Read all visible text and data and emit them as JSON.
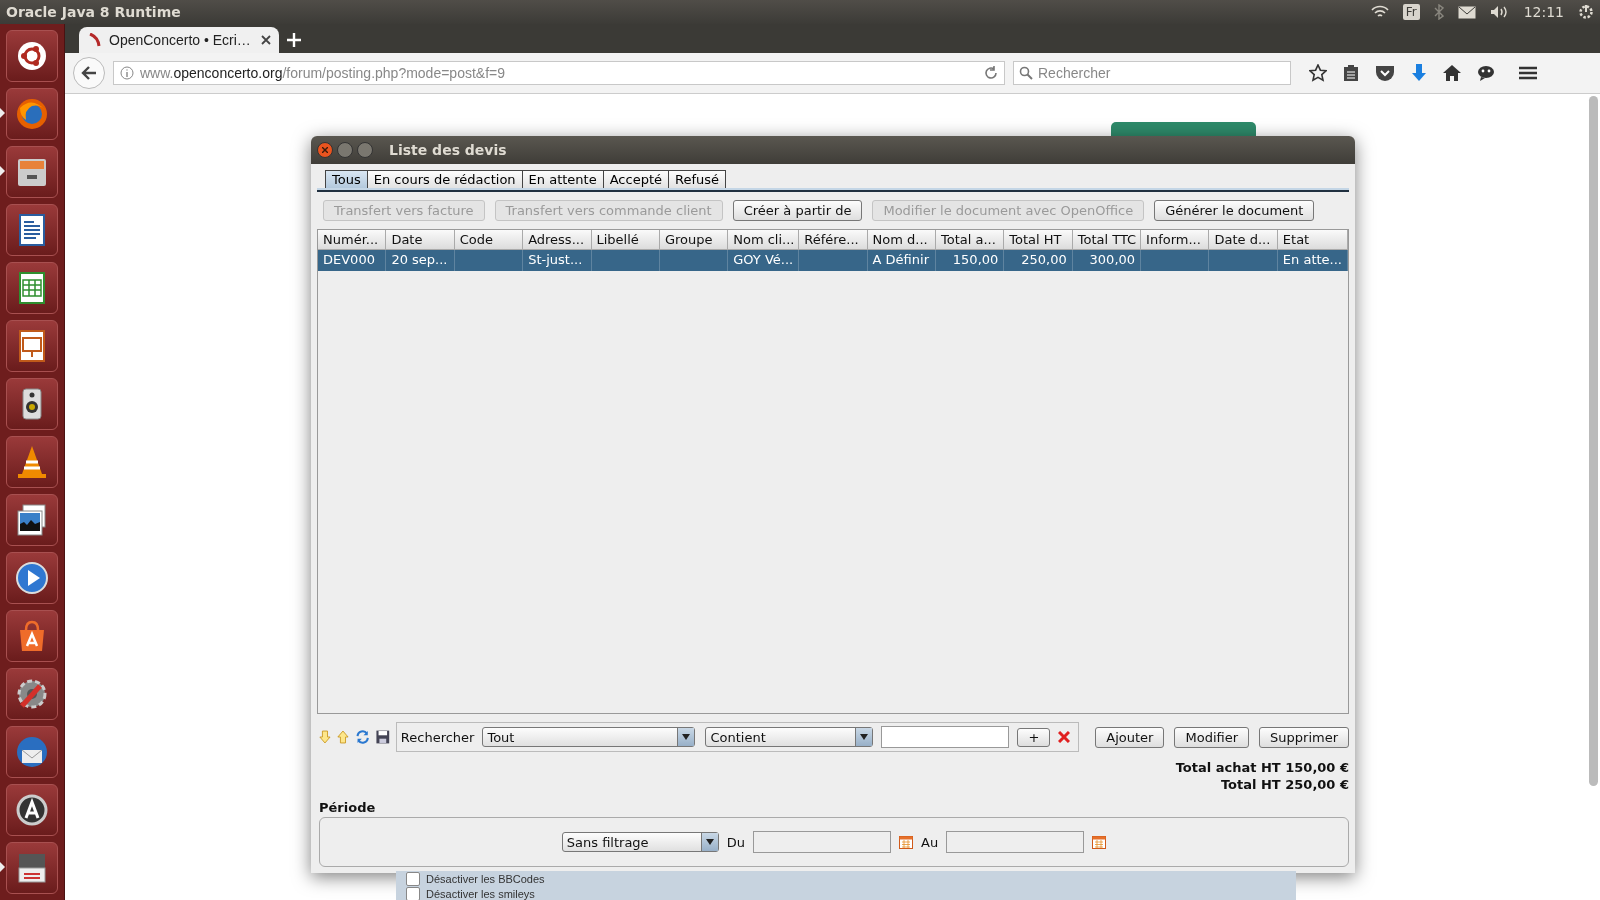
{
  "top_panel": {
    "title": "Oracle Java 8 Runtime",
    "keyboard_layout": "Fr",
    "clock": "12:11"
  },
  "launcher": [
    {
      "running": false
    },
    {
      "running": true
    },
    {
      "running": true
    },
    {
      "running": false
    },
    {
      "running": false
    },
    {
      "running": false
    },
    {
      "running": false
    },
    {
      "running": false
    },
    {
      "running": false
    },
    {
      "running": false
    },
    {
      "running": false
    },
    {
      "running": false
    },
    {
      "running": false
    },
    {
      "running": false
    },
    {
      "running": true
    }
  ],
  "browser": {
    "tab": {
      "title": "OpenConcerto • Ecri…"
    },
    "url": "www.openconcerto.org/forum/posting.php?mode=post&f=9",
    "search": {
      "placeholder": "Rechercher"
    }
  },
  "page": {
    "options": [
      {
        "label": "Désactiver les BBCodes",
        "checked": false
      },
      {
        "label": "Désactiver les smileys",
        "checked": false
      }
    ]
  },
  "dialog": {
    "title": "Liste des devis",
    "tabs": [
      {
        "label": "Tous",
        "selected": true
      },
      {
        "label": "En cours de rédaction",
        "selected": false
      },
      {
        "label": "En attente",
        "selected": false
      },
      {
        "label": "Accepté",
        "selected": false
      },
      {
        "label": "Refusé",
        "selected": false
      }
    ],
    "actions": [
      {
        "label": "Transfert vers facture",
        "disabled": true
      },
      {
        "label": "Transfert vers commande client",
        "disabled": true
      },
      {
        "label": "Créer à partir de",
        "disabled": false
      },
      {
        "label": "Modifier le document avec OpenOffice",
        "disabled": true
      },
      {
        "label": "Générer le document",
        "disabled": false
      }
    ],
    "table": {
      "columns": [
        {
          "label": "Numér..."
        },
        {
          "label": "Date"
        },
        {
          "label": "Code"
        },
        {
          "label": "Adress..."
        },
        {
          "label": "Libellé"
        },
        {
          "label": "Groupe"
        },
        {
          "label": "Nom cli..."
        },
        {
          "label": "Référe..."
        },
        {
          "label": "Nom d..."
        },
        {
          "label": "Total a...",
          "numeric": true
        },
        {
          "label": "Total HT",
          "numeric": true
        },
        {
          "label": "Total TTC",
          "numeric": true
        },
        {
          "label": "Inform..."
        },
        {
          "label": "Date d..."
        },
        {
          "label": "Etat"
        }
      ],
      "rows": [
        {
          "selected": true,
          "cells": [
            "DEV000",
            "20 sep...",
            "",
            " St-just...",
            "",
            "",
            "GOY Vé...",
            "",
            "A Définir",
            "150,00",
            "250,00",
            "300,00",
            "",
            "",
            "En atte..."
          ]
        }
      ]
    },
    "search_bar": {
      "label": "Rechercher",
      "field": "Tout",
      "operator": "Contient",
      "add_button": "+",
      "buttons": [
        "Ajouter",
        "Modifier",
        "Supprimer"
      ]
    },
    "totals": [
      "Total achat HT 150,00 €",
      "Total HT 250,00 €"
    ],
    "period": {
      "title": "Période",
      "filter": "Sans filtrage",
      "from_label": "Du",
      "to_label": "Au"
    }
  }
}
